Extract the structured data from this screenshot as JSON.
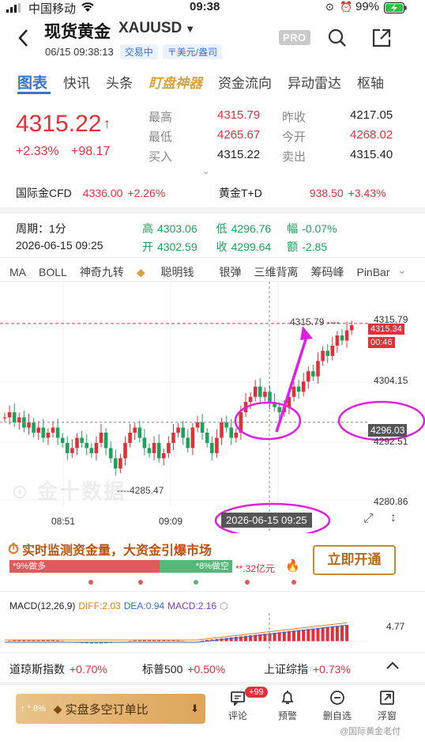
{
  "status_bar": {
    "carrier": "中国移动",
    "time": "09:38",
    "battery": "99%"
  },
  "header": {
    "title": "现货黄金",
    "symbol": "XAUUSD",
    "datetime": "06/15 09:38:13",
    "badge_trading": "交易中",
    "badge_unit": "〒美元/盎司",
    "pro_label": "PRO"
  },
  "tabs": [
    "图表",
    "快讯",
    "头条",
    "盯盘神器",
    "资金流向",
    "异动雷达",
    "枢轴"
  ],
  "quote": {
    "price": "4315.22",
    "change_pct": "+2.33%",
    "change_abs": "+98.17",
    "high_label": "最高",
    "high": "4315.79",
    "low_label": "最低",
    "low": "4265.67",
    "bid_label": "买入",
    "bid": "4315.22",
    "prev_close_label": "昨收",
    "prev_close": "4217.05",
    "open_label": "今开",
    "open": "4268.02",
    "ask_label": "卖出",
    "ask": "4315.40"
  },
  "related": [
    {
      "name": "国际金CFD",
      "price": "4336.00",
      "change": "+2.26%"
    },
    {
      "name": "黄金T+D",
      "price": "938.50",
      "change": "+3.43%"
    }
  ],
  "period": {
    "period_label": "周期：1分",
    "time": "2026-06-15 09:25",
    "high_label": "高",
    "high": "4303.06",
    "low_label": "低",
    "low": "4296.76",
    "amp_label": "幅",
    "amp": "-0.07%",
    "open_label": "开",
    "open": "4302.59",
    "close_label": "收",
    "close": "4299.64",
    "amt_label": "额",
    "amt": "-2.85"
  },
  "indicators": [
    "MA",
    "BOLL",
    "神奇九转",
    "聪明钱",
    "银弹",
    "三维背离",
    "筹码峰",
    "PinBar"
  ],
  "chart": {
    "y_labels": [
      "4315.79",
      "4304.15",
      "4292.51",
      "4280.86"
    ],
    "current_price_tag": "4315.34",
    "countdown_tag": "00:46",
    "crosshair_tag": "4296.03",
    "crosshair_time": "2026-06-15 09:25",
    "high_mark": "4315.79",
    "low_mark": "4285.47",
    "x_labels": [
      "08:51",
      "09:09"
    ],
    "watermark": "金十数据",
    "colors": {
      "up": "#e0313b",
      "down": "#1aa35a",
      "annotation": "#e020e0"
    }
  },
  "promo": {
    "text": "实时监测资金量，大资金引爆市场",
    "bull_label": "*9%做多",
    "bear_label": "*8%做空",
    "amount": "**.32亿元",
    "button": "立即开通"
  },
  "macd": {
    "label": "MACD(12,26,9)",
    "diff": "DIFF:2.03",
    "dea": "DEA:0.94",
    "macd": "MACD:2.16",
    "axis_value": "4.77"
  },
  "indices": [
    {
      "name": "道琼斯指数",
      "change": "+0.70%"
    },
    {
      "name": "标普500",
      "change": "+0.50%"
    },
    {
      "name": "上证综指",
      "change": "+0.73%"
    }
  ],
  "bottom_bar": {
    "order_badge": "↑ *.8%",
    "order_text": "实盘多空订单比",
    "comment": "评论",
    "comment_badge": "+99",
    "alert": "预警",
    "remove": "删自选",
    "float": "浮窗"
  },
  "footer_watermark": "@国际黄金老付"
}
